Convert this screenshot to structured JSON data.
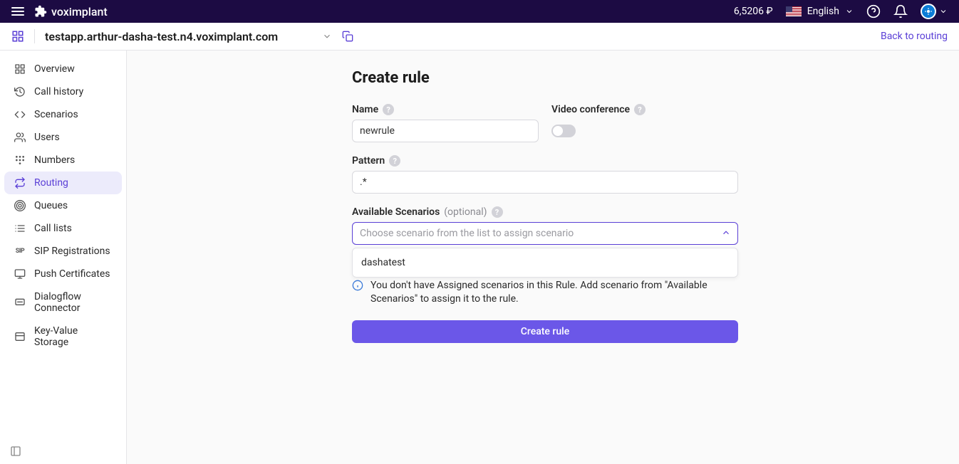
{
  "topbar": {
    "brand": "voximplant",
    "balance": "6,5206 ₽",
    "language": "English"
  },
  "subbar": {
    "app_domain": "testapp.arthur-dasha-test.n4.voximplant.com",
    "back_link": "Back to routing"
  },
  "sidebar": {
    "items": [
      {
        "label": "Overview",
        "icon": "overview"
      },
      {
        "label": "Call history",
        "icon": "history"
      },
      {
        "label": "Scenarios",
        "icon": "code"
      },
      {
        "label": "Users",
        "icon": "users"
      },
      {
        "label": "Numbers",
        "icon": "dialpad"
      },
      {
        "label": "Routing",
        "icon": "routing",
        "active": true
      },
      {
        "label": "Queues",
        "icon": "queues"
      },
      {
        "label": "Call lists",
        "icon": "list"
      },
      {
        "label": "SIP Registrations",
        "icon": "sip"
      },
      {
        "label": "Push Certificates",
        "icon": "push"
      },
      {
        "label": "Dialogflow Connector",
        "icon": "dialogflow"
      },
      {
        "label": "Key-Value Storage",
        "icon": "kv"
      }
    ]
  },
  "form": {
    "title": "Create rule",
    "name_label": "Name",
    "name_value": "newrule",
    "videoconf_label": "Video conference",
    "pattern_label": "Pattern",
    "pattern_value": ".*",
    "scenarios_label": "Available Scenarios",
    "scenarios_optional": "(optional)",
    "scenarios_placeholder": "Choose scenario from the list to assign scenario",
    "dropdown_options": [
      "dashatest"
    ],
    "info_text": "You don't have Assigned scenarios in this Rule. Add scenario from \"Available Scenarios\" to assign it to the rule.",
    "submit_label": "Create rule"
  }
}
